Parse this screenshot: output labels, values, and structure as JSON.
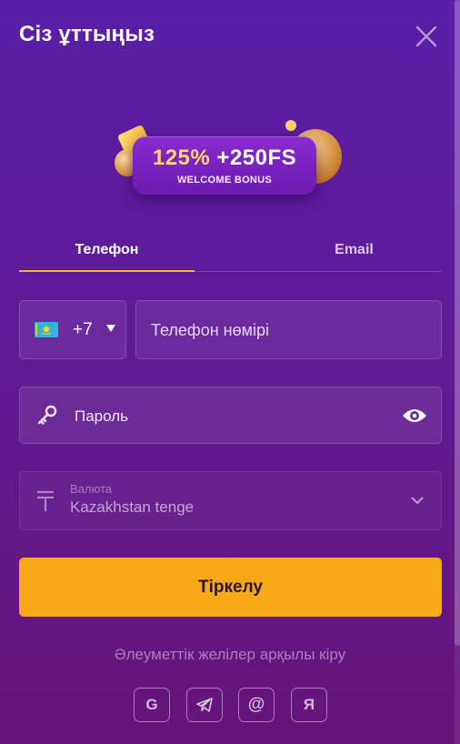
{
  "header": {
    "title": "Сіз ұттыңыз",
    "close_icon": "close-icon"
  },
  "banner": {
    "percent": "125%",
    "freespins": "+250FS",
    "subtitle": "WELCOME BONUS",
    "gold_color": "#ffd86a"
  },
  "tabs": [
    {
      "label": "Телефон",
      "active": true
    },
    {
      "label": "Email",
      "active": false
    }
  ],
  "phone": {
    "country_flag": "kazakhstan-flag",
    "country_code": "+7",
    "placeholder": "Телефон нөмірі"
  },
  "password": {
    "placeholder": "Пароль",
    "icon": "key-icon",
    "toggle_icon": "eye-icon"
  },
  "currency": {
    "label": "Валюта",
    "value": "Kazakhstan tenge",
    "icon": "tenge-icon"
  },
  "submit": {
    "label": "Тіркелу",
    "color": "#f8a916"
  },
  "social": {
    "caption": "Әлеуметтік желілер арқылы кіру",
    "providers": [
      {
        "name": "google",
        "glyph": "G"
      },
      {
        "name": "telegram",
        "glyph": ""
      },
      {
        "name": "mail",
        "glyph": "@"
      },
      {
        "name": "yandex",
        "glyph": "Я"
      }
    ]
  },
  "colors": {
    "accent": "#f9b51c",
    "background": "#5f1a95"
  }
}
